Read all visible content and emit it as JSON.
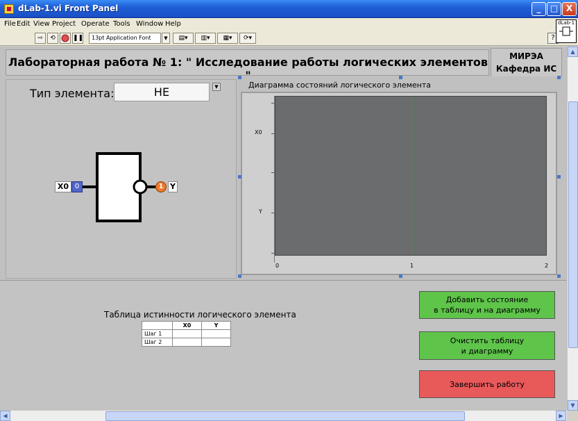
{
  "window": {
    "title": "dLab-1.vi Front Panel",
    "minimize_label": "_",
    "maximize_label": "□",
    "close_label": "X"
  },
  "menu": [
    "File",
    "Edit",
    "View",
    "Project",
    "Operate",
    "Tools",
    "Window",
    "Help"
  ],
  "toolbar": {
    "font_select": "13pt Application Font",
    "vi_icon_text": "dLab-1",
    "help_label": "?"
  },
  "header": {
    "title": "Лабораторная работа № 1: \" Исследование работы логических элементов \"",
    "org_line1": "МИРЭА",
    "org_line2": "Кафедра ИС"
  },
  "element_type": {
    "label": "Тип элемента:",
    "value": "НЕ"
  },
  "gate": {
    "input_label": "X0",
    "input_value": "0",
    "output_label": "Y",
    "output_value": "1"
  },
  "chart": {
    "title": "Диаграмма состояний логического элемента",
    "y_ticks": [
      "X0",
      "Y"
    ],
    "x_ticks": [
      "0",
      "1",
      "2"
    ],
    "cursor_x": 1,
    "cursor_color": "#2ea12e",
    "plot_bg": "#6b6c6e"
  },
  "truth_table": {
    "title": "Таблица истинности логического элемента",
    "headers": [
      "X0",
      "Y"
    ],
    "rows": [
      {
        "label": "Шаг 1",
        "x0": "",
        "y": ""
      },
      {
        "label": "Шаг 2",
        "x0": "",
        "y": ""
      }
    ]
  },
  "buttons": {
    "add_line1": "Добавить состояние",
    "add_line2": "в таблицу и на диаграмму",
    "clear_line1": "Очистить таблицу",
    "clear_line2": "и диаграмму",
    "finish": "Завершить работу"
  }
}
